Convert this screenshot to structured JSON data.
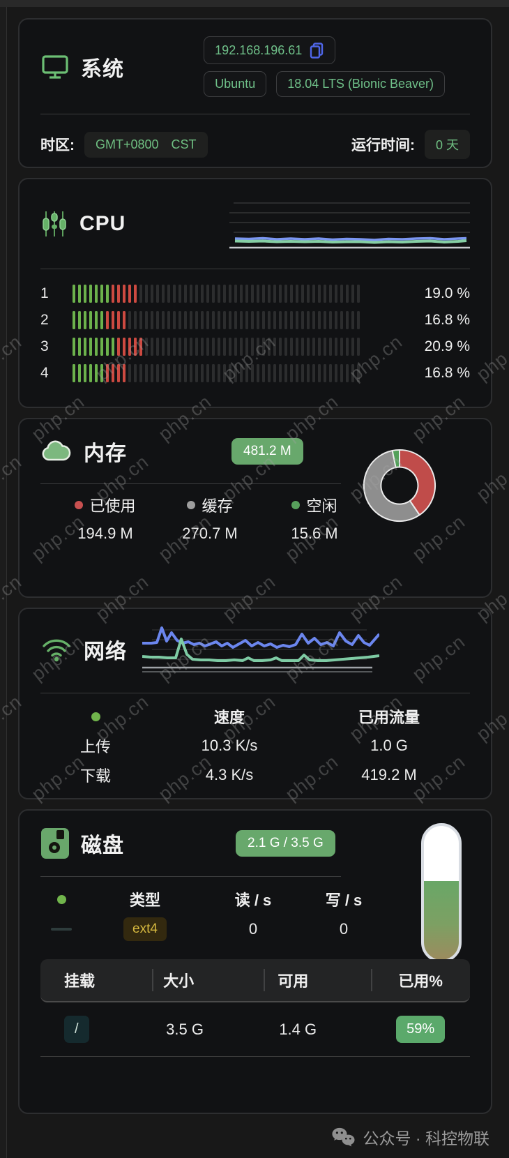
{
  "watermark": {
    "text": "php.cn"
  },
  "system": {
    "title": "系统",
    "ip": "192.168.196.61",
    "os_name": "Ubuntu",
    "os_version": "18.04 LTS (Bionic Beaver)",
    "timezone_label": "时区:",
    "timezone_value": "GMT+0800",
    "timezone_abbr": "CST",
    "uptime_label": "运行时间:",
    "uptime_value": "0 天"
  },
  "cpu": {
    "title": "CPU",
    "segments_total": 52,
    "cores": [
      {
        "index": "1",
        "percent": "19.0 %",
        "green": 7,
        "red": 5
      },
      {
        "index": "2",
        "percent": "16.8 %",
        "green": 6,
        "red": 4
      },
      {
        "index": "3",
        "percent": "20.9 %",
        "green": 8,
        "red": 5
      },
      {
        "index": "4",
        "percent": "16.8 %",
        "green": 6,
        "red": 4
      }
    ]
  },
  "memory": {
    "title": "内存",
    "total_badge": "481.2 M",
    "donut": {
      "used_pct": 40.5,
      "cached_pct": 56.3,
      "free_pct": 3.2
    },
    "colors": {
      "used": "#c04c4a",
      "cached": "#8e8e8e",
      "free": "#53a05a"
    },
    "legend": [
      {
        "label": "已使用",
        "value": "194.9 M",
        "color": "#c85050"
      },
      {
        "label": "缓存",
        "value": "270.7 M",
        "color": "#9e9e9e"
      },
      {
        "label": "空闲",
        "value": "15.6 M",
        "color": "#57a05c"
      }
    ]
  },
  "network": {
    "title": "网络",
    "headers": {
      "speed": "速度",
      "traffic": "已用流量"
    },
    "rows": [
      {
        "label": "上传",
        "speed": "10.3 K/s",
        "traffic": "1.0 G"
      },
      {
        "label": "下载",
        "speed": "4.3 K/s",
        "traffic": "419.2 M"
      }
    ]
  },
  "disk": {
    "title": "磁盘",
    "usage_badge": "2.1 G / 3.5 G",
    "gauge_percent": 59,
    "io": {
      "headers": {
        "type": "类型",
        "read": "读 / s",
        "write": "写 / s"
      },
      "row": {
        "type": "ext4",
        "read": "0",
        "write": "0"
      }
    },
    "table": {
      "headers": [
        "挂载",
        "大小",
        "可用",
        "已用%"
      ],
      "rows": [
        {
          "mount": "/",
          "size": "3.5 G",
          "avail": "1.4 G",
          "used": "59%"
        }
      ]
    }
  },
  "footer": {
    "label": "公众号 · 科控物联"
  }
}
